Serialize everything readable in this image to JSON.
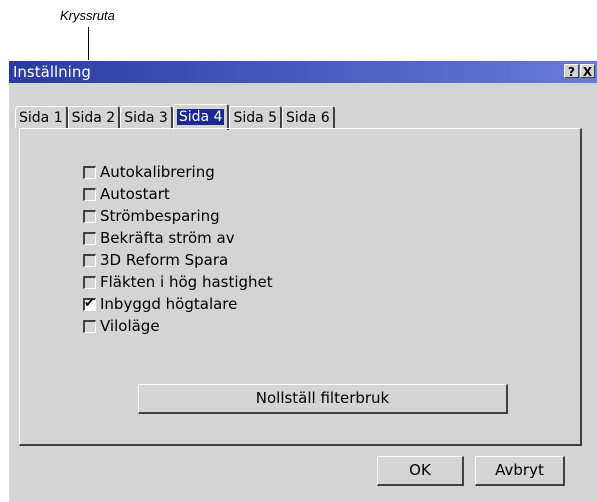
{
  "callout": {
    "label": "Kryssruta"
  },
  "dialog": {
    "title": "Inställning",
    "help_button": "?",
    "close_button": "X",
    "tabs": [
      {
        "label": "Sida 1",
        "active": false
      },
      {
        "label": "Sida 2",
        "active": false
      },
      {
        "label": "Sida 3",
        "active": false
      },
      {
        "label": "Sida 4",
        "active": true
      },
      {
        "label": "Sida 5",
        "active": false
      },
      {
        "label": "Sida 6",
        "active": false
      }
    ],
    "options": [
      {
        "label": "Autokalibrering",
        "checked": false
      },
      {
        "label": "Autostart",
        "checked": false
      },
      {
        "label": "Strömbesparing",
        "checked": false
      },
      {
        "label": "Bekräfta ström av",
        "checked": false
      },
      {
        "label": "3D Reform Spara",
        "checked": false
      },
      {
        "label": "Fläkten i hög hastighet",
        "checked": false
      },
      {
        "label": "Inbyggd högtalare",
        "checked": true
      },
      {
        "label": "Viloläge",
        "checked": false
      }
    ],
    "reset_button": "Nollställ filterbruk",
    "ok_button": "OK",
    "cancel_button": "Avbryt"
  },
  "colors": {
    "titlebar": "#2a3aa0",
    "active_tab": "#1a2a90",
    "face": "#d4d4d4"
  }
}
